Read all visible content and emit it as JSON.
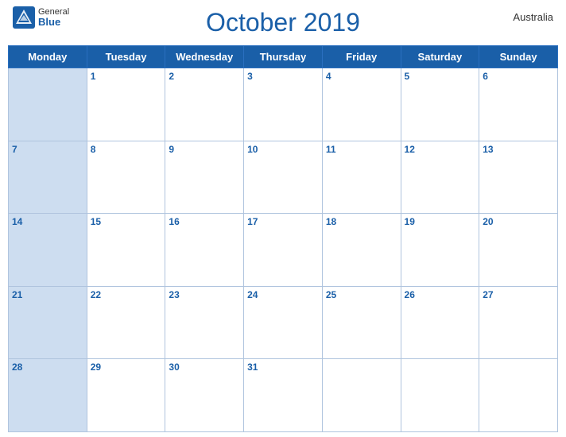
{
  "header": {
    "logo_general": "General",
    "logo_blue": "Blue",
    "title": "October 2019",
    "country": "Australia"
  },
  "weekdays": [
    "Monday",
    "Tuesday",
    "Wednesday",
    "Thursday",
    "Friday",
    "Saturday",
    "Sunday"
  ],
  "weeks": [
    [
      null,
      "1",
      "2",
      "3",
      "4",
      "5",
      "6"
    ],
    [
      "7",
      "8",
      "9",
      "10",
      "11",
      "12",
      "13"
    ],
    [
      "14",
      "15",
      "16",
      "17",
      "18",
      "19",
      "20"
    ],
    [
      "21",
      "22",
      "23",
      "24",
      "25",
      "26",
      "27"
    ],
    [
      "28",
      "29",
      "30",
      "31",
      null,
      null,
      null
    ]
  ]
}
